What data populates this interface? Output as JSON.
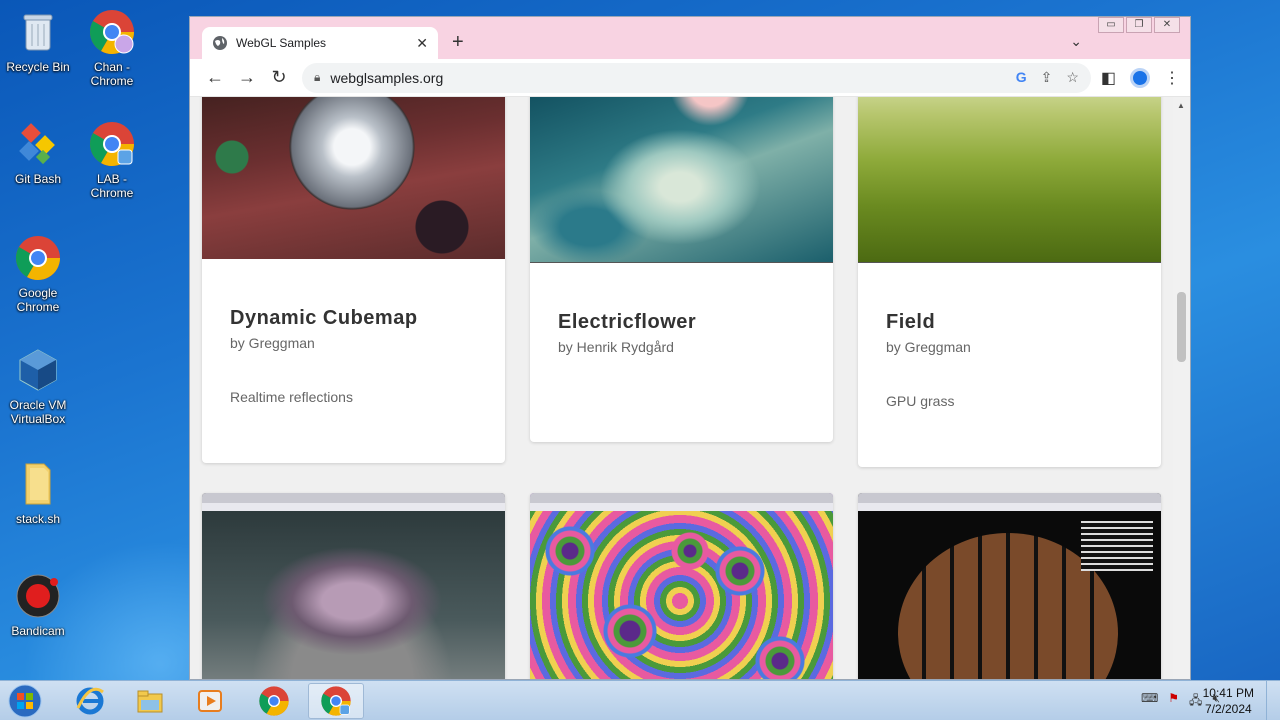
{
  "desktop": {
    "icons": [
      {
        "label": "Recycle Bin"
      },
      {
        "label": "Chan -\nChrome"
      },
      {
        "label": "Git Bash"
      },
      {
        "label": "LAB -\nChrome"
      },
      {
        "label": "Google\nChrome"
      },
      {
        "label": "Oracle VM\nVirtualBox"
      },
      {
        "label": "stack.sh"
      },
      {
        "label": "Bandicam"
      }
    ]
  },
  "browser": {
    "tab_title": "WebGL Samples",
    "url": "webglsamples.org"
  },
  "cards": [
    {
      "title": "Dynamic Cubemap",
      "author": "by Greggman",
      "desc": "Realtime reflections"
    },
    {
      "title": "Electricflower",
      "author": "by Henrik Rydgård",
      "desc": ""
    },
    {
      "title": "Field",
      "author": "by Greggman",
      "desc": "GPU grass"
    }
  ],
  "taskbar": {
    "time": "10:41 PM",
    "date": "7/2/2024"
  }
}
